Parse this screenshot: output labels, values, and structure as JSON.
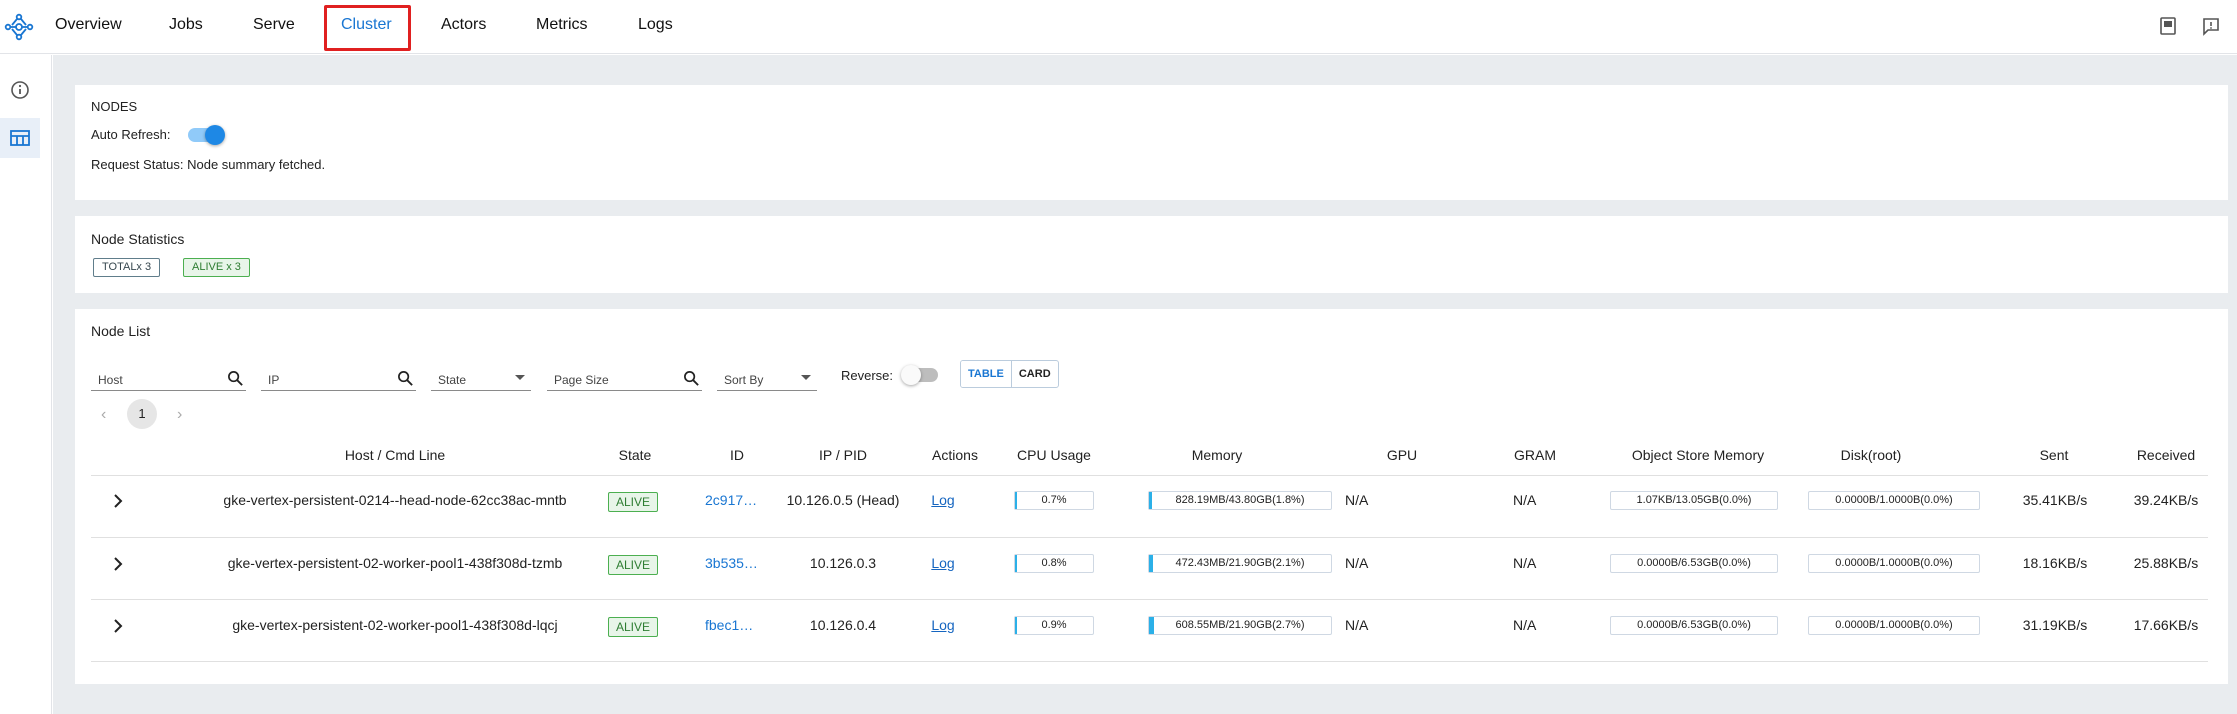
{
  "nav": {
    "items": [
      "Overview",
      "Jobs",
      "Serve",
      "Cluster",
      "Actors",
      "Metrics",
      "Logs"
    ],
    "active": "Cluster",
    "highlight_color": "#e02020",
    "icons": [
      "docs-icon",
      "feedback-icon"
    ]
  },
  "sidebar": {
    "icons": [
      "info-icon",
      "table-view-icon"
    ]
  },
  "nodes_panel": {
    "title": "NODES",
    "auto_refresh_label": "Auto Refresh:",
    "auto_refresh_on": true,
    "request_status": "Request Status: Node summary fetched."
  },
  "stats_panel": {
    "title": "Node Statistics",
    "total_tag": "TOTALx 3",
    "alive_tag": "ALIVE x 3"
  },
  "list_panel": {
    "title": "Node List",
    "filters": {
      "host": "Host",
      "ip": "IP",
      "state": "State",
      "page_size": "Page Size",
      "sort_by": "Sort By"
    },
    "reverse_label": "Reverse:",
    "reverse_on": false,
    "view_table": "TABLE",
    "view_card": "CARD",
    "active_view": "TABLE",
    "page": "1",
    "prev": "‹",
    "next": "›",
    "columns": [
      "Host / Cmd Line",
      "State",
      "ID",
      "IP / PID",
      "Actions",
      "CPU Usage",
      "Memory",
      "GPU",
      "GRAM",
      "Object Store Memory",
      "Disk(root)",
      "Sent",
      "Received"
    ],
    "rows": [
      {
        "host": "gke-vertex-persistent-0214--head-node-62cc38ac-mntb",
        "state": "ALIVE",
        "id": "2c917…",
        "ip": "10.126.0.5 (Head)",
        "action": "Log",
        "cpu": "0.7%",
        "cpu_pct": 0.7,
        "memory": "828.19MB/43.80GB(1.8%)",
        "mem_pct": 1.8,
        "gpu": "N/A",
        "gram": "N/A",
        "object_store": "1.07KB/13.05GB(0.0%)",
        "disk": "0.0000B/1.0000B(0.0%)",
        "sent": "35.41KB/s",
        "received": "39.24KB/s"
      },
      {
        "host": "gke-vertex-persistent-02-worker-pool1-438f308d-tzmb",
        "state": "ALIVE",
        "id": "3b535…",
        "ip": "10.126.0.3",
        "action": "Log",
        "cpu": "0.8%",
        "cpu_pct": 0.8,
        "memory": "472.43MB/21.90GB(2.1%)",
        "mem_pct": 2.1,
        "gpu": "N/A",
        "gram": "N/A",
        "object_store": "0.0000B/6.53GB(0.0%)",
        "disk": "0.0000B/1.0000B(0.0%)",
        "sent": "18.16KB/s",
        "received": "25.88KB/s"
      },
      {
        "host": "gke-vertex-persistent-02-worker-pool1-438f308d-lqcj",
        "state": "ALIVE",
        "id": "fbec1…",
        "ip": "10.126.0.4",
        "action": "Log",
        "cpu": "0.9%",
        "cpu_pct": 0.9,
        "memory": "608.55MB/21.90GB(2.7%)",
        "mem_pct": 2.7,
        "gpu": "N/A",
        "gram": "N/A",
        "object_store": "0.0000B/6.53GB(0.0%)",
        "disk": "0.0000B/1.0000B(0.0%)",
        "sent": "31.19KB/s",
        "received": "17.66KB/s"
      }
    ]
  },
  "colors": {
    "accent": "#1976d2",
    "alive": "#2e7d32",
    "bar": "#2bb0e8",
    "background": "#e9ecef"
  }
}
